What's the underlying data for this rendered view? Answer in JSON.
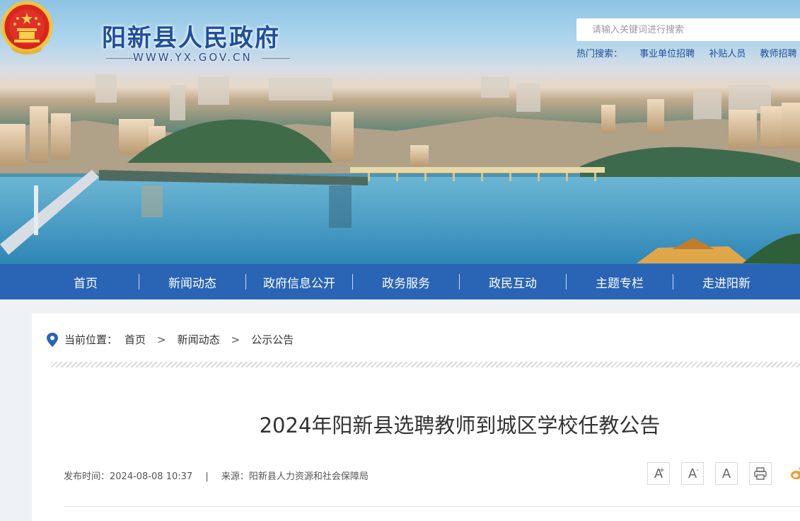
{
  "header": {
    "site_name": "阳新县人民政府",
    "site_domain": "WWW.YX.GOV.CN",
    "search_placeholder": "请输入关键词进行搜索",
    "hot_label": "热门搜索：",
    "hot_links": [
      "事业单位招聘",
      "补贴人员",
      "教师招聘"
    ]
  },
  "nav": {
    "items": [
      "首页",
      "新闻动态",
      "政府信息公开",
      "政务服务",
      "政民互动",
      "主题专栏",
      "走进阳新"
    ]
  },
  "breadcrumb": {
    "label": "当前位置：",
    "items": [
      "首页",
      "新闻动态",
      "公示公告"
    ],
    "separator": ">"
  },
  "article": {
    "title": "2024年阳新县选聘教师到城区学校任教公告",
    "publish_label": "发布时间：",
    "publish_time": "2024-08-08 10:37",
    "divider": "|",
    "source_label": "来源：",
    "source": "阳新县人力资源和社会保障局"
  },
  "tools": {
    "font_large": "A",
    "font_large_mark": "+",
    "font_small": "A",
    "font_small_mark": "-",
    "font_default": "A",
    "print_icon": "printer-icon",
    "share_icon": "weibo-icon"
  },
  "colors": {
    "nav_bg": "#2a64b4",
    "brand_blue": "#1f4f9e",
    "page_bg": "#eef1f5"
  }
}
